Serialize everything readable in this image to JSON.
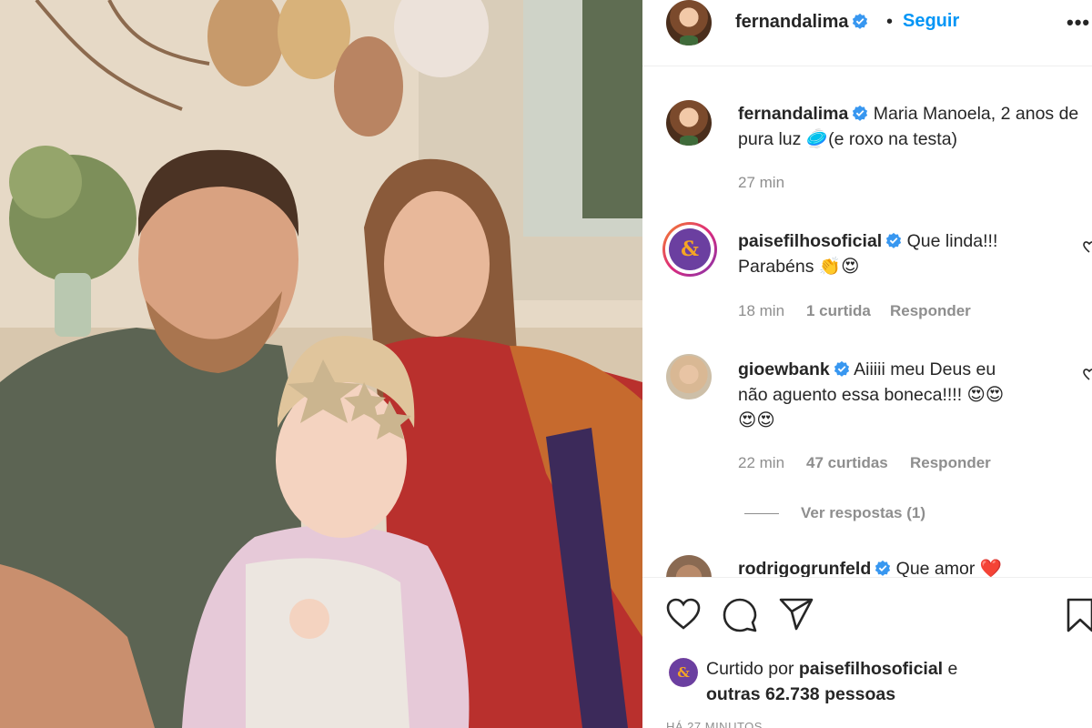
{
  "post": {
    "username": "fernandalima",
    "follow_label": "Seguir",
    "separator": "•",
    "more_label": "•••",
    "caption_text": "Maria Manoela, 2 anos de pura luz 🥏(e roxo na testa)",
    "caption_time": "27 min"
  },
  "comments": [
    {
      "username": "paisefilhosoficial",
      "text_line1": "Que linda!!!",
      "text_line2": "Parabéns 👏😍",
      "time": "18 min",
      "likes": "1 curtida",
      "reply_label": "Responder"
    },
    {
      "username": "gioewbank",
      "text_line1": "Aiiiii meu Deus eu",
      "text_line2": "não aguento essa boneca!!!! 😍😍",
      "text_line3": "😍😍",
      "time": "22 min",
      "likes": "47 curtidas",
      "reply_label": "Responder",
      "view_replies": "Ver respostas (1)"
    },
    {
      "username": "rodrigogrunfeld",
      "text_line1": "Que amor ❤️"
    }
  ],
  "liked_by": {
    "prefix": "Curtido por",
    "user": "paisefilhosoficial",
    "joiner": "e",
    "others": "outras 62.738 pessoas"
  },
  "timestamp": "HÁ 27 MINUTOS",
  "icons": [
    "heart-icon",
    "comment-icon",
    "share-icon",
    "bookmark-icon",
    "verified-icon",
    "more-options-icon"
  ],
  "colors": {
    "follow": "#0095f6",
    "verified": "#3897f0",
    "meta": "#8e8e8e",
    "text": "#262626"
  }
}
